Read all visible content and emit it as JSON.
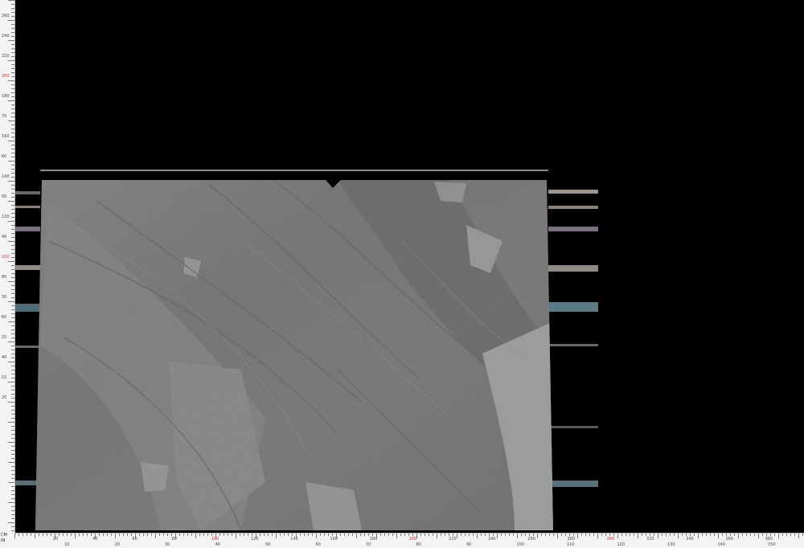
{
  "ruler": {
    "unit_cm": "CM",
    "unit_in": "IN",
    "left_labels": [
      "260",
      "240",
      "220",
      "200",
      "180",
      "70",
      "160",
      "60",
      "140",
      "50",
      "120",
      "40",
      "100",
      "80",
      "30",
      "60",
      "20",
      "40",
      "10",
      "20"
    ],
    "bottom_cm_labels": [
      "20",
      "40",
      "60",
      "80",
      "100",
      "120",
      "140",
      "160",
      "180",
      "200",
      "220",
      "240",
      "260",
      "280",
      "300",
      "320",
      "340",
      "360",
      "380"
    ],
    "bottom_in_labels": [
      "10",
      "20",
      "30",
      "40",
      "50",
      "60",
      "70",
      "80",
      "90",
      "100",
      "110",
      "120",
      "130",
      "140",
      "150"
    ]
  },
  "colors": {
    "background": "#000000",
    "ruler_bg": "#f4f4f4",
    "accent_red": "#dd2222",
    "slab_base": "#6e6e6e"
  }
}
